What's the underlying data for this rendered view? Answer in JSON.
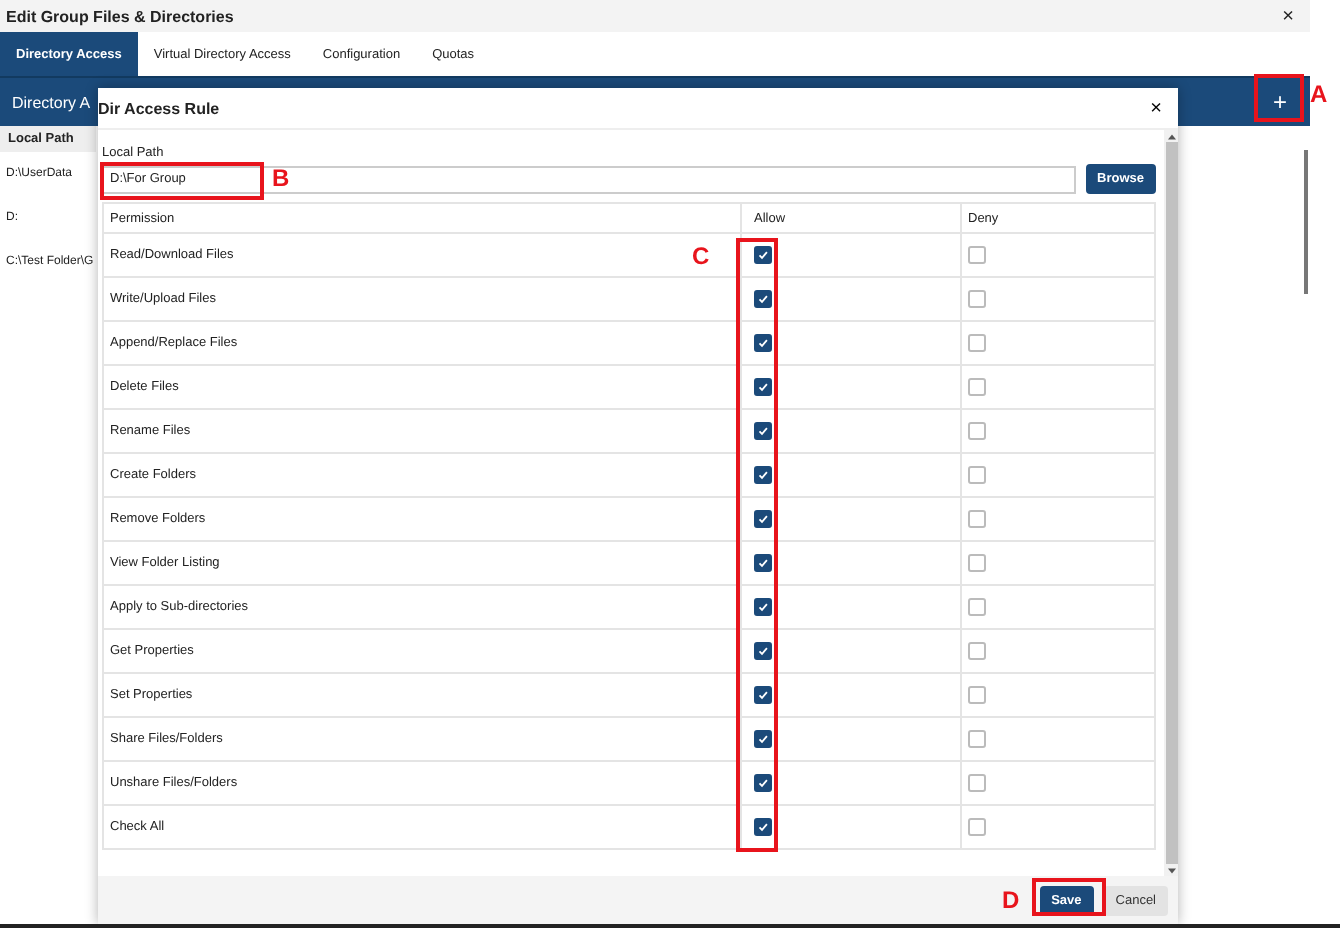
{
  "window": {
    "title": "Edit Group Files & Directories",
    "close": "×"
  },
  "tabs": [
    {
      "label": "Directory Access",
      "selected": true
    },
    {
      "label": "Virtual Directory Access",
      "selected": false
    },
    {
      "label": "Configuration",
      "selected": false
    },
    {
      "label": "Quotas",
      "selected": false
    }
  ],
  "panel": {
    "title": "Directory A",
    "add_button": "+"
  },
  "paths": {
    "header": "Local Path",
    "rows": [
      "D:\\UserData",
      "D:",
      "C:\\Test Folder\\G"
    ]
  },
  "dialog": {
    "title": "Dir Access Rule",
    "close": "×",
    "field_label": "Local Path",
    "value": "D:\\For Group",
    "browse": "Browse",
    "columns": [
      "Permission",
      "Allow",
      "Deny"
    ],
    "permissions": [
      {
        "name": "Read/Download Files",
        "allow": true,
        "deny": false
      },
      {
        "name": "Write/Upload Files",
        "allow": true,
        "deny": false
      },
      {
        "name": "Append/Replace Files",
        "allow": true,
        "deny": false
      },
      {
        "name": "Delete Files",
        "allow": true,
        "deny": false
      },
      {
        "name": "Rename Files",
        "allow": true,
        "deny": false
      },
      {
        "name": "Create Folders",
        "allow": true,
        "deny": false
      },
      {
        "name": "Remove Folders",
        "allow": true,
        "deny": false
      },
      {
        "name": "View Folder Listing",
        "allow": true,
        "deny": false
      },
      {
        "name": "Apply to Sub-directories",
        "allow": true,
        "deny": false
      },
      {
        "name": "Get Properties",
        "allow": true,
        "deny": false
      },
      {
        "name": "Set Properties",
        "allow": true,
        "deny": false
      },
      {
        "name": "Share Files/Folders",
        "allow": true,
        "deny": false
      },
      {
        "name": "Unshare Files/Folders",
        "allow": true,
        "deny": false
      },
      {
        "name": "Check All",
        "allow": true,
        "deny": false
      }
    ],
    "buttons": [
      {
        "label": "Save",
        "kind": "primary"
      },
      {
        "label": "Cancel",
        "kind": "secondary"
      }
    ]
  },
  "annotations": [
    {
      "label": "A"
    },
    {
      "label": "B"
    },
    {
      "label": "C"
    },
    {
      "label": "D"
    }
  ]
}
